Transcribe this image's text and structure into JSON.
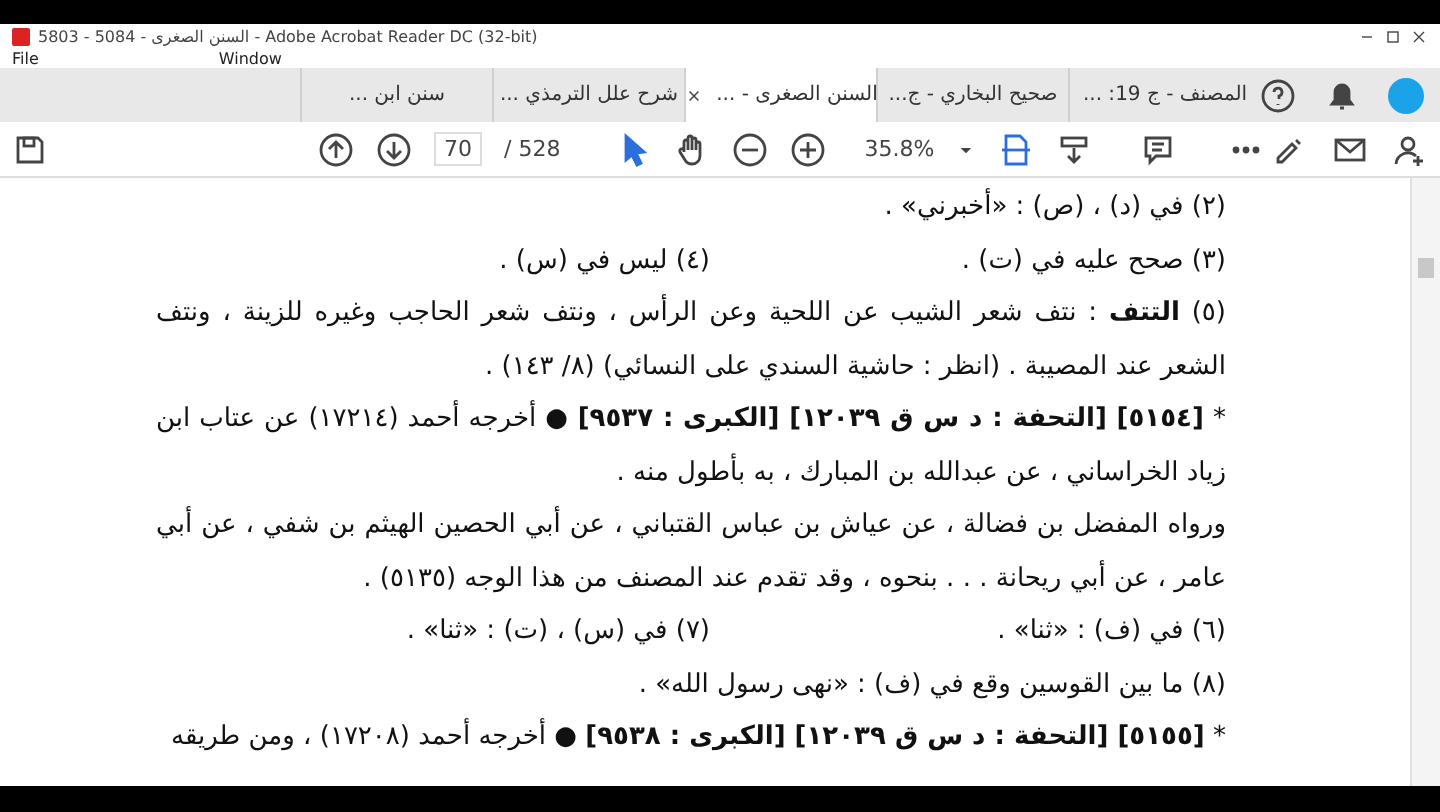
{
  "window": {
    "title": "5803 - 5084 - السنن الصغرى - Adobe Acrobat Reader DC (32-bit)"
  },
  "menu": [
    "Window",
    "File"
  ],
  "tabs": [
    {
      "label": "المصنف - ج 19: ...",
      "selected": false
    },
    {
      "label": "صحيح البخاري - ج...",
      "selected": false
    },
    {
      "label": "السنن الصغرى - ...",
      "selected": true
    },
    {
      "label": "شرح علل الترمذي ...",
      "selected": false
    },
    {
      "label": "سنن ابن ...",
      "selected": false
    }
  ],
  "toolbar": {
    "page_number": "70",
    "page_total": "/ 528",
    "zoom": "35.8%"
  },
  "document": {
    "blocks": [
      {
        "kind": "note",
        "text": "(٢) في (د) ، (ص) : «أخبرني» ."
      },
      {
        "kind": "pair",
        "items": [
          "(٣) صحح عليه في (ت) .",
          "(٤) ليس في (س) ."
        ]
      },
      {
        "kind": "note",
        "text": "(٥) **التتف** : نتف شعر الشيب عن اللحية وعن الرأس ، ونتف شعر الحاجب وغيره للزينة ، ونتف الشعر عند المصيبة . (انظر : حاشية السندي على النسائي) (٨/ ١٤٣) ."
      },
      {
        "kind": "entry",
        "text": "* **[٥١٥٤] [التحفة : د س ق ١٢٠٣٩] [الكبرى : ٩٥٣٧]** ● أخرجه أحمد (١٧٢١٤) عن عتاب ابن زياد الخراساني ، عن عبدالله بن المبارك ، به بأطول منه ."
      },
      {
        "kind": "entry",
        "text": "ورواه المفضل بن فضالة ، عن عياش بن عباس القتباني ، عن أبي الحصين الهيثم بن شفي ، عن أبي عامر ، عن أبي ريحانة . . . بنحوه ، وقد تقدم عند المصنف من هذا الوجه (٥١٣٥) ."
      },
      {
        "kind": "pair",
        "items": [
          "(٦) في (ف) : «ثنا» .",
          "(٧) في (س) ، (ت) : «ثنا» ."
        ]
      },
      {
        "kind": "note",
        "text": "(٨) ما بين القوسين وقع في (ف) : «نهى رسول الله» ."
      },
      {
        "kind": "entry",
        "text": "* **[٥١٥٥] [التحفة : د س ق ١٢٠٣٩] [الكبرى : ٩٥٣٨]** ● أخرجه أحمد (١٧٢٠٨) ، ومن طريقه"
      }
    ]
  }
}
